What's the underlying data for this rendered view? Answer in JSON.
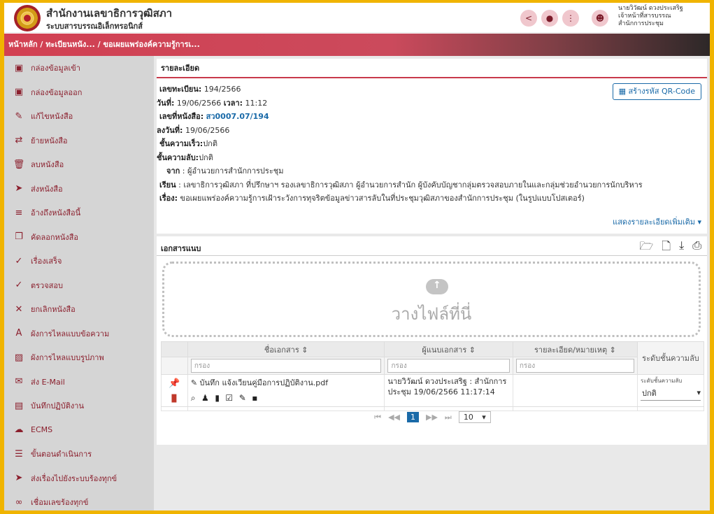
{
  "header": {
    "org_title": "สำนักงานเลขาธิการวุฒิสภา",
    "org_subtitle": "ระบบสารบรรณอิเล็กทรอนิกส์",
    "icons": [
      "share-icon",
      "bell-icon",
      "apps-icon",
      "user-icon"
    ],
    "user_line1": "นายวิวัฒน์ ดวงประเสริฐ",
    "user_line2": "เจ้าหน้าที่สารบรรณ",
    "user_line3": "สำนักการประชุม"
  },
  "breadcrumb": "หน้าหลัก / ทะเบียนหนัง... / ขอเผยแพร่องค์ความรู้การเ...",
  "sidebar": {
    "items": [
      {
        "label": "กล่องข้อมูลเข้า",
        "icon": "inbox-icon",
        "glyph": "▣"
      },
      {
        "label": "กล่องข้อมูลออก",
        "icon": "outbox-icon",
        "glyph": "▣"
      },
      {
        "label": "แก้ไขหนังสือ",
        "icon": "pencil-icon",
        "glyph": "✎"
      },
      {
        "label": "ย้ายหนังสือ",
        "icon": "swap-icon",
        "glyph": "⇄"
      },
      {
        "label": "ลบหนังสือ",
        "icon": "trash-icon",
        "glyph": "🗑"
      },
      {
        "label": "ส่งหนังสือ",
        "icon": "send-icon",
        "glyph": "➤"
      },
      {
        "label": "อ้างถึงหนังสือนี้",
        "icon": "reference-icon",
        "glyph": "≡"
      },
      {
        "label": "คัดลอกหนังสือ",
        "icon": "copy-icon",
        "glyph": "❐"
      },
      {
        "label": "เรื่องเสร็จ",
        "icon": "done-icon",
        "glyph": "✓"
      },
      {
        "label": "ตรวจสอบ",
        "icon": "check-icon",
        "glyph": "✓"
      },
      {
        "label": "ยกเลิกหนังสือ",
        "icon": "cancel-icon",
        "glyph": "✕"
      },
      {
        "label": "ผังการไหลแบบข้อความ",
        "icon": "text-flow-icon",
        "glyph": "A"
      },
      {
        "label": "ผังการไหลแบบรูปภาพ",
        "icon": "image-flow-icon",
        "glyph": "▨"
      },
      {
        "label": "ส่ง E-Mail",
        "icon": "email-icon",
        "glyph": "✉"
      },
      {
        "label": "บันทึกปฏิบัติงาน",
        "icon": "log-icon",
        "glyph": "▤"
      },
      {
        "label": "ECMS",
        "icon": "cloud-icon",
        "glyph": "☁"
      },
      {
        "label": "ขั้นตอนดำเนินการ",
        "icon": "steps-icon",
        "glyph": "☰"
      },
      {
        "label": "ส่งเรื่องไปยังระบบร้องทุกข์",
        "icon": "forward-icon",
        "glyph": "➤"
      },
      {
        "label": "เชื่อมเลขร้องทุกข์",
        "icon": "link-icon",
        "glyph": "∞"
      }
    ]
  },
  "detail": {
    "title": "รายละเอียด",
    "qr_button": "สร้างรหัส QR-Code",
    "reg_no_label": "เลขทะเบียน:",
    "reg_no": "194/2566",
    "date_label": "วันที่:",
    "date": "19/06/2566",
    "time_label": "เวลา:",
    "time": "11:12",
    "doc_no_label": "เลขที่หนังสือ:",
    "doc_no": "สว0007.07/194",
    "signed_label": "ลงวันที่:",
    "signed": "19/06/2566",
    "urgency_label": "ชั้นความเร็ว:",
    "urgency": "ปกติ",
    "secret_label": "ชั้นความลับ:",
    "secret": "ปกติ",
    "from_label": "จาก",
    "from": ": ผู้อำนวยการสำนักการประชุม",
    "to_label": "เรียน",
    "to": ": เลขาธิการวุฒิสภา ที่ปรึกษาฯ รองเลขาธิการวุฒิสภา ผู้อำนวยการสำนัก ผู้บังคับบัญชากลุ่มตรวจสอบภายในและกลุ่มช่วยอำนวยการนักบริหาร",
    "subject_label": "เรื่อง:",
    "subject": "ขอเผยแพร่องค์ความรู้การเฝ้าระวังการทุจริตข้อมูลข่าวสารลับในที่ประชุมวุฒิสภาของสำนักการประชุม (ในรูปแบบโปสเตอร์)",
    "more": "แสดงรายละเอียดเพิ่มเติม ▾"
  },
  "attachments": {
    "title": "เอกสารแนบ",
    "drop_text": "วางไฟล์ที่นี่",
    "columns": [
      "ชื่อเอกสาร ⇕",
      "ผู้แนบเอกสาร ⇕",
      "รายละเอียด/หมายเหตุ ⇕",
      "ระดับชั้นความลับ"
    ],
    "filter_placeholder": "กรอง",
    "row": {
      "filename": "บันทึก แจ้งเวียนคู่มือการปฏิบัติงาน.pdf",
      "attached_by": "นายวิวัฒน์ ดวงประเสริฐ : สำนักการประชุม 19/06/2566 11:17:14",
      "note": "",
      "secret_label": "ระดับชั้นความลับ",
      "secret_value": "ปกติ"
    },
    "pager": {
      "current": "1",
      "page_size": "10"
    }
  }
}
